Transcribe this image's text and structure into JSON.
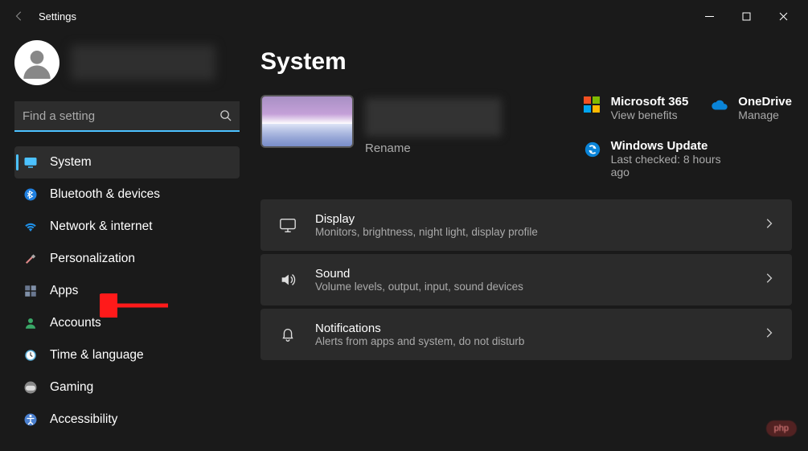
{
  "window": {
    "title": "Settings"
  },
  "search": {
    "placeholder": "Find a setting"
  },
  "sidebar": {
    "items": [
      {
        "label": "System"
      },
      {
        "label": "Bluetooth & devices"
      },
      {
        "label": "Network & internet"
      },
      {
        "label": "Personalization"
      },
      {
        "label": "Apps"
      },
      {
        "label": "Accounts"
      },
      {
        "label": "Time & language"
      },
      {
        "label": "Gaming"
      },
      {
        "label": "Accessibility"
      }
    ]
  },
  "page": {
    "heading": "System",
    "rename": "Rename"
  },
  "status": {
    "m365_title": "Microsoft 365",
    "m365_sub": "View benefits",
    "onedrive_title": "OneDrive",
    "onedrive_sub": "Manage",
    "update_title": "Windows Update",
    "update_sub": "Last checked: 8 hours ago"
  },
  "cards": [
    {
      "title": "Display",
      "sub": "Monitors, brightness, night light, display profile"
    },
    {
      "title": "Sound",
      "sub": "Volume levels, output, input, sound devices"
    },
    {
      "title": "Notifications",
      "sub": "Alerts from apps and system, do not disturb"
    }
  ],
  "badge": "php"
}
